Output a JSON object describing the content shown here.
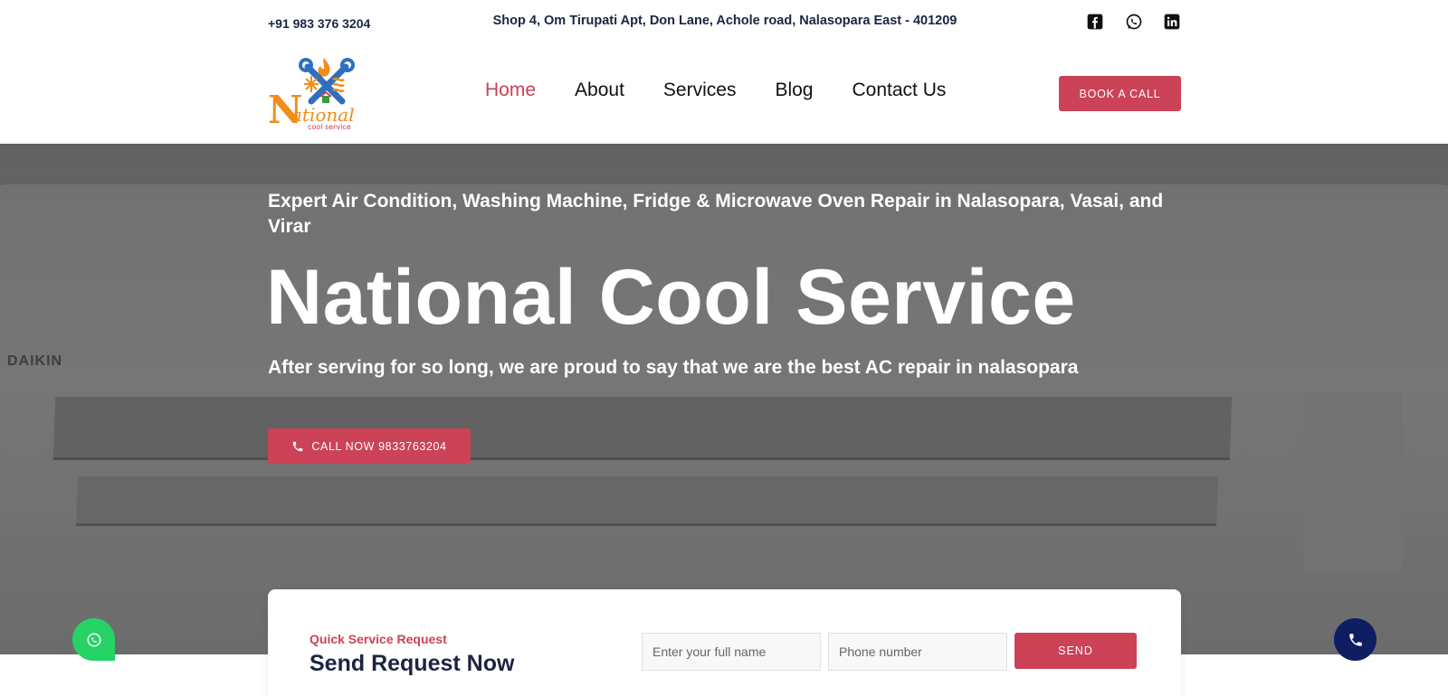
{
  "topbar": {
    "phone": "+91 983 376 3204",
    "address": "Shop 4, Om Tirupati Apt, Don Lane, Achole road, Nalasopara East - 401209",
    "social": [
      "facebook-icon",
      "whatsapp-icon",
      "linkedin-icon"
    ]
  },
  "header": {
    "logo_text": "National",
    "logo_subtext": "cool service",
    "nav": [
      {
        "label": "Home",
        "active": true
      },
      {
        "label": "About"
      },
      {
        "label": "Services"
      },
      {
        "label": "Blog"
      },
      {
        "label": "Contact Us"
      }
    ],
    "book_label": "BOOK A CALL"
  },
  "hero": {
    "subtitle": "Expert Air Condition, Washing Machine, Fridge & Microwave Oven Repair in Nalasopara, Vasai, and Virar",
    "title": "National Cool Service",
    "tagline": "After serving for so long, we are proud to say that we are the best AC repair in nalasopara",
    "call_label": "CALL NOW 9833763204",
    "background_brand": "DAIKIN"
  },
  "request": {
    "kicker": "Quick Service Request",
    "title": "Send Request Now",
    "name_placeholder": "Enter your full name",
    "phone_placeholder": "Phone number",
    "send_label": "SEND"
  },
  "colors": {
    "accent": "#cc4257",
    "navy": "#1b2541",
    "whatsapp": "#25d366",
    "phone_float": "#0f1e63"
  }
}
